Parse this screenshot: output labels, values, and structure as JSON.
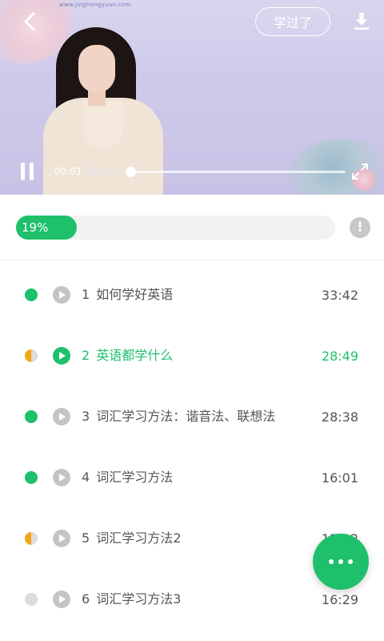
{
  "video": {
    "watermark": "www.jinghongyuan.com",
    "learned_button": "学过了",
    "current_time": "00:01",
    "duration": "28:49",
    "playback_state": "playing",
    "icons": {
      "back": "chevron-left-icon",
      "download": "download-icon",
      "pause": "pause-icon",
      "fullscreen": "fullscreen-icon"
    }
  },
  "progress": {
    "percent": 19,
    "label": "19%",
    "info_icon": "info-icon"
  },
  "lessons": [
    {
      "num": "1",
      "title": "如何学好英语",
      "duration": "33:42",
      "status": "done",
      "active": false
    },
    {
      "num": "2",
      "title": "英语都学什么",
      "duration": "28:49",
      "status": "half",
      "active": true
    },
    {
      "num": "3",
      "title": "词汇学习方法：谐音法、联想法",
      "duration": "28:38",
      "status": "done",
      "active": false
    },
    {
      "num": "4",
      "title": "词汇学习方法",
      "duration": "16:01",
      "status": "done",
      "active": false
    },
    {
      "num": "5",
      "title": "词汇学习方法2",
      "duration": "12:12",
      "status": "half",
      "active": false
    },
    {
      "num": "6",
      "title": "词汇学习方法3",
      "duration": "16:29",
      "status": "none",
      "active": false
    }
  ],
  "fab": {
    "icon": "more-dots-icon"
  },
  "colors": {
    "accent": "#1ec06c",
    "partial": "#f0a818",
    "inactive": "#dcdcdc",
    "text": "#555555"
  }
}
